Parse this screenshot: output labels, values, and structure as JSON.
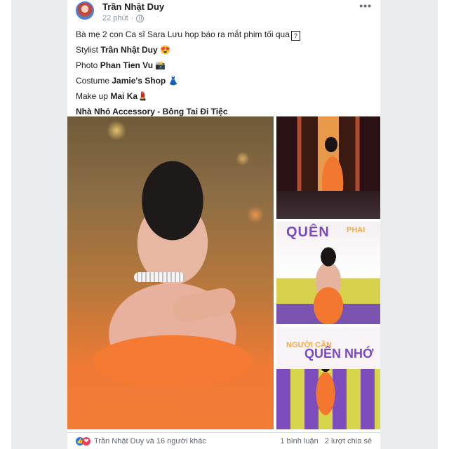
{
  "post": {
    "author": "Trần Nhật Duy",
    "time": "22 phút",
    "dot": "·",
    "more": "•••",
    "lines": [
      {
        "pre": "Bà mẹ 2 con Ca sĩ Sara Lưu họp báo ra mắt phim tối qua",
        "bold": "",
        "suffix": "?"
      },
      {
        "pre": "Stylist ",
        "bold": "Trần Nhật Duy",
        "suffix": "😍"
      },
      {
        "pre": "Photo ",
        "bold": "Phan Tien Vu",
        "suffix": "📸"
      },
      {
        "pre": "Costume ",
        "bold": "Jamie's Shop",
        "suffix": "👗"
      },
      {
        "pre": "Make up ",
        "bold": "Mai Ka",
        "suffix": "💄"
      },
      {
        "pre": "",
        "bold": "Nhà Nhỏ Accessory - Bông Tai Đi Tiệc",
        "suffix": ""
      }
    ]
  },
  "photos": {
    "poster_title": "QUÊN",
    "poster_sub": "PHAI",
    "poster2_small": "NGƯỜI CẦN",
    "poster2_big": "QUÊN NHỚ"
  },
  "footer": {
    "like_icon": "👍",
    "love_icon": "❤",
    "reactions": "Trần Nhật Duy và 16 người khác",
    "comments": "1 bình luận",
    "shares": "2 lượt chia sẻ"
  }
}
